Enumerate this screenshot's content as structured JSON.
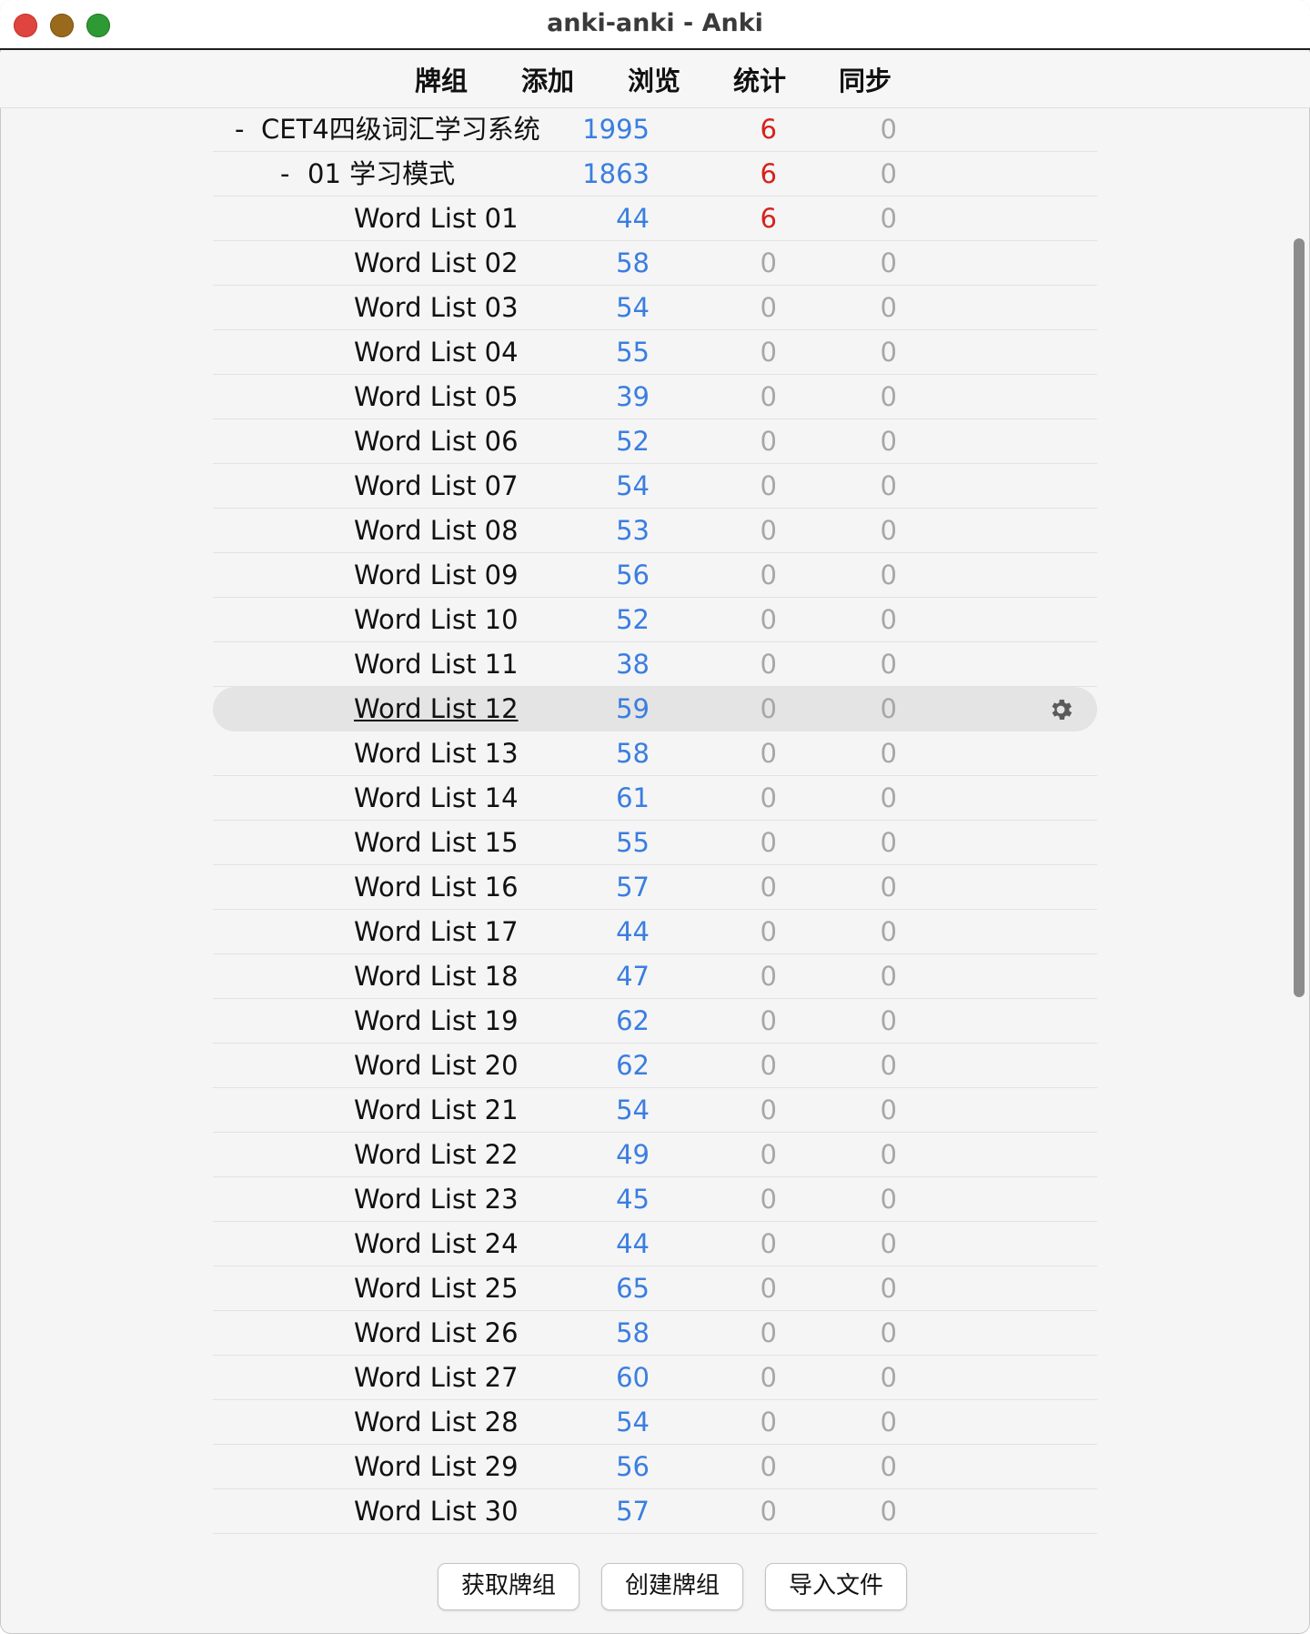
{
  "window": {
    "title": "anki-anki - Anki"
  },
  "toolbar": [
    "牌组",
    "添加",
    "浏览",
    "统计",
    "同步"
  ],
  "decks": [
    {
      "collapse": "-",
      "name": "CET4四级词汇学习系统",
      "level": 0,
      "new": "1995",
      "learn": "6",
      "due": "0"
    },
    {
      "collapse": "-",
      "name": "01 学习模式",
      "level": 1,
      "new": "1863",
      "learn": "6",
      "due": "0"
    },
    {
      "collapse": "",
      "name": "Word List 01",
      "level": 2,
      "new": "44",
      "learn": "6",
      "due": "0"
    },
    {
      "collapse": "",
      "name": "Word List 02",
      "level": 2,
      "new": "58",
      "learn": "0",
      "due": "0"
    },
    {
      "collapse": "",
      "name": "Word List 03",
      "level": 2,
      "new": "54",
      "learn": "0",
      "due": "0"
    },
    {
      "collapse": "",
      "name": "Word List 04",
      "level": 2,
      "new": "55",
      "learn": "0",
      "due": "0"
    },
    {
      "collapse": "",
      "name": "Word List 05",
      "level": 2,
      "new": "39",
      "learn": "0",
      "due": "0"
    },
    {
      "collapse": "",
      "name": "Word List 06",
      "level": 2,
      "new": "52",
      "learn": "0",
      "due": "0"
    },
    {
      "collapse": "",
      "name": "Word List 07",
      "level": 2,
      "new": "54",
      "learn": "0",
      "due": "0"
    },
    {
      "collapse": "",
      "name": "Word List 08",
      "level": 2,
      "new": "53",
      "learn": "0",
      "due": "0"
    },
    {
      "collapse": "",
      "name": "Word List 09",
      "level": 2,
      "new": "56",
      "learn": "0",
      "due": "0"
    },
    {
      "collapse": "",
      "name": "Word List 10",
      "level": 2,
      "new": "52",
      "learn": "0",
      "due": "0"
    },
    {
      "collapse": "",
      "name": "Word List 11",
      "level": 2,
      "new": "38",
      "learn": "0",
      "due": "0"
    },
    {
      "collapse": "",
      "name": "Word List 12",
      "level": 2,
      "new": "59",
      "learn": "0",
      "due": "0",
      "selected": true
    },
    {
      "collapse": "",
      "name": "Word List 13",
      "level": 2,
      "new": "58",
      "learn": "0",
      "due": "0"
    },
    {
      "collapse": "",
      "name": "Word List 14",
      "level": 2,
      "new": "61",
      "learn": "0",
      "due": "0"
    },
    {
      "collapse": "",
      "name": "Word List 15",
      "level": 2,
      "new": "55",
      "learn": "0",
      "due": "0"
    },
    {
      "collapse": "",
      "name": "Word List 16",
      "level": 2,
      "new": "57",
      "learn": "0",
      "due": "0"
    },
    {
      "collapse": "",
      "name": "Word List 17",
      "level": 2,
      "new": "44",
      "learn": "0",
      "due": "0"
    },
    {
      "collapse": "",
      "name": "Word List 18",
      "level": 2,
      "new": "47",
      "learn": "0",
      "due": "0"
    },
    {
      "collapse": "",
      "name": "Word List 19",
      "level": 2,
      "new": "62",
      "learn": "0",
      "due": "0"
    },
    {
      "collapse": "",
      "name": "Word List 20",
      "level": 2,
      "new": "62",
      "learn": "0",
      "due": "0"
    },
    {
      "collapse": "",
      "name": "Word List 21",
      "level": 2,
      "new": "54",
      "learn": "0",
      "due": "0"
    },
    {
      "collapse": "",
      "name": "Word List 22",
      "level": 2,
      "new": "49",
      "learn": "0",
      "due": "0"
    },
    {
      "collapse": "",
      "name": "Word List 23",
      "level": 2,
      "new": "45",
      "learn": "0",
      "due": "0"
    },
    {
      "collapse": "",
      "name": "Word List 24",
      "level": 2,
      "new": "44",
      "learn": "0",
      "due": "0"
    },
    {
      "collapse": "",
      "name": "Word List 25",
      "level": 2,
      "new": "65",
      "learn": "0",
      "due": "0"
    },
    {
      "collapse": "",
      "name": "Word List 26",
      "level": 2,
      "new": "58",
      "learn": "0",
      "due": "0"
    },
    {
      "collapse": "",
      "name": "Word List 27",
      "level": 2,
      "new": "60",
      "learn": "0",
      "due": "0"
    },
    {
      "collapse": "",
      "name": "Word List 28",
      "level": 2,
      "new": "54",
      "learn": "0",
      "due": "0"
    },
    {
      "collapse": "",
      "name": "Word List 29",
      "level": 2,
      "new": "56",
      "learn": "0",
      "due": "0"
    },
    {
      "collapse": "",
      "name": "Word List 30",
      "level": 2,
      "new": "57",
      "learn": "0",
      "due": "0"
    }
  ],
  "bottom_buttons": [
    "获取牌组",
    "创建牌组",
    "导入文件"
  ],
  "icons": {
    "options": "gear-icon"
  },
  "colors": {
    "new": "#3a7ee0",
    "learn": "#d6221b",
    "zero": "#a7a7a7",
    "selected_row": "#e4e4e4"
  }
}
